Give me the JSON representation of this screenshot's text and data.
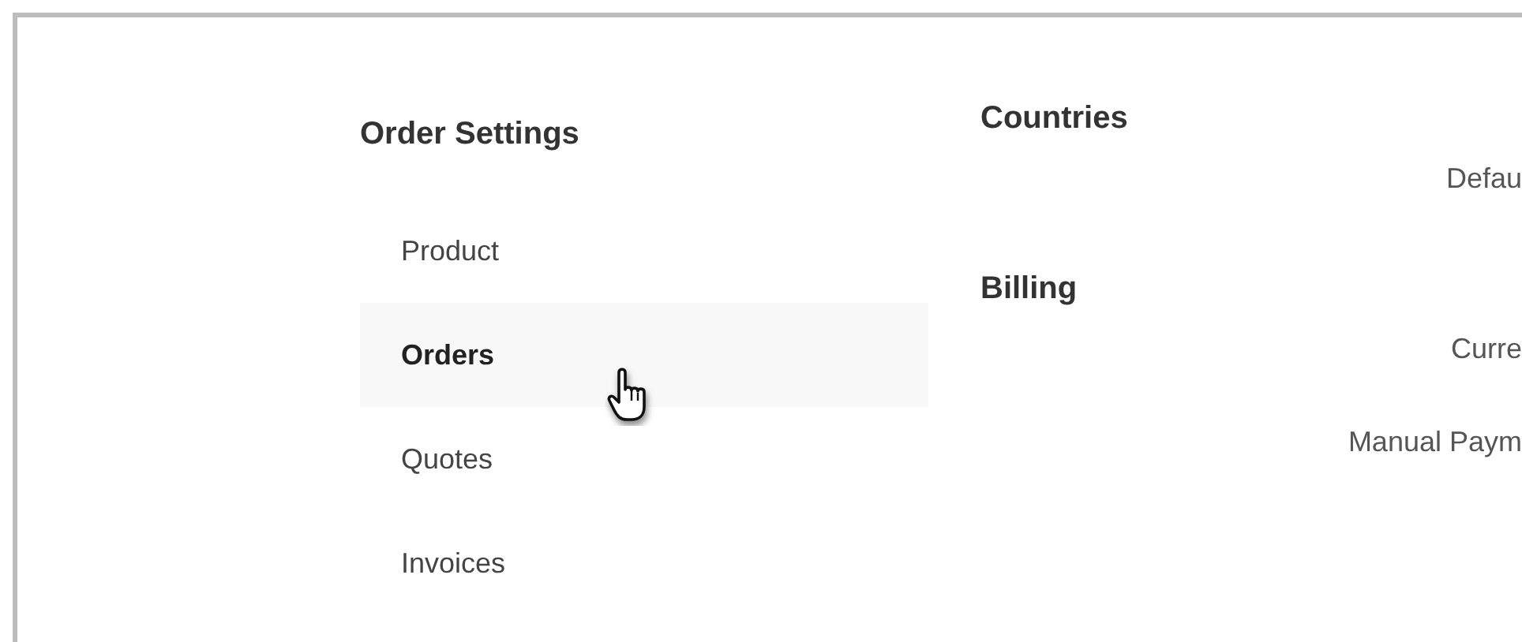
{
  "sidebar": {
    "title": "Order Settings",
    "items": [
      {
        "label": "Product",
        "selected": false
      },
      {
        "label": "Orders",
        "selected": true
      },
      {
        "label": "Quotes",
        "selected": false
      },
      {
        "label": "Invoices",
        "selected": false
      }
    ]
  },
  "sections": [
    {
      "title": "Countries",
      "fields": [
        "Defau"
      ]
    },
    {
      "title": "Billing",
      "fields": [
        "Curre",
        "Manual Paym"
      ]
    }
  ]
}
